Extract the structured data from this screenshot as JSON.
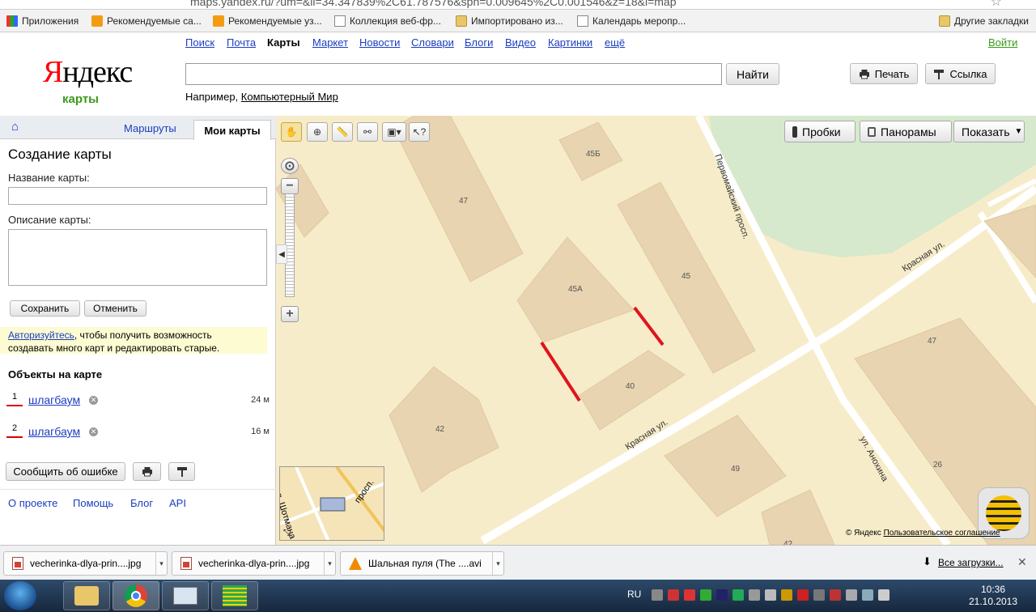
{
  "browser": {
    "url": "maps.yandex.ru/?um=&ll=34.347839%2C61.787576&spn=0.009645%2C0.001546&z=18&l=map",
    "bookmarks": [
      {
        "label": "Приложения",
        "icon": "apps-icon"
      },
      {
        "label": "Рекомендуемые са...",
        "icon": "bookmark-orange-icon"
      },
      {
        "label": "Рекомендуемые уз...",
        "icon": "bookmark-orange-icon"
      },
      {
        "label": "Коллекция веб-фр...",
        "icon": "page-icon"
      },
      {
        "label": "Импортировано из...",
        "icon": "folder-icon"
      },
      {
        "label": "Календарь меропр...",
        "icon": "page-icon"
      }
    ],
    "other_bookmarks": "Другие закладки"
  },
  "header": {
    "logo_ya": "Я",
    "logo_rest": "ндекс",
    "logo_sub": "карты",
    "services": [
      "Поиск",
      "Почта",
      "Карты",
      "Маркет",
      "Новости",
      "Словари",
      "Блоги",
      "Видео",
      "Картинки",
      "ещё"
    ],
    "active_service": "Карты",
    "login": "Войти",
    "search_value": "",
    "search_button": "Найти",
    "example_prefix": "Например,",
    "example_link": "Компьютерный Мир",
    "print_label": "Печать",
    "link_label": "Ссылка"
  },
  "sidebar": {
    "tab_routes": "Маршруты",
    "tab_mymaps": "Мои карты",
    "title": "Создание карты",
    "name_label": "Название карты:",
    "name_value": "",
    "desc_label": "Описание карты:",
    "desc_value": "",
    "save": "Сохранить",
    "cancel": "Отменить",
    "notice_link": "Авторизуйтесь",
    "notice_text": ", чтобы получить возможность создавать много карт и редактировать старые.",
    "objects_title": "Объекты на карте",
    "objects": [
      {
        "num": "1",
        "name": "шлагбаум",
        "dist": "24 м"
      },
      {
        "num": "2",
        "name": "шлагбаум",
        "dist": "16 м"
      }
    ],
    "report_error": "Сообщить об ошибке",
    "footer": [
      "О проекте",
      "Помощь",
      "Блог",
      "API"
    ]
  },
  "map": {
    "traffic": "Пробки",
    "panoramas": "Панорамы",
    "show": "Показать",
    "buildings": [
      "45Б",
      "47",
      "45А",
      "45",
      "40",
      "42",
      "47",
      "49",
      "26",
      "42"
    ],
    "streets": [
      "Первомайский просп.",
      "Красная ул.",
      "Красная ул.",
      "ул. Анохина"
    ],
    "minimap_labels": [
      "л. Шотмана",
      "просп."
    ],
    "copyright": "© Яндекс",
    "terms": "Пользовательское соглашение",
    "road_color": "#ffffff",
    "building_color": "#e8d4b0",
    "park_color": "#d6e9cd",
    "barrier_color": "#e0141e"
  },
  "downloads": {
    "items": [
      {
        "label": "vecherinka-dlya-prin....jpg"
      },
      {
        "label": "vecherinka-dlya-prin....jpg"
      },
      {
        "label": "Шальная пуля (The ....avi"
      }
    ],
    "all": "Все загрузки..."
  },
  "taskbar": {
    "lang": "RU",
    "time": "10:36",
    "date": "21.10.2013"
  }
}
